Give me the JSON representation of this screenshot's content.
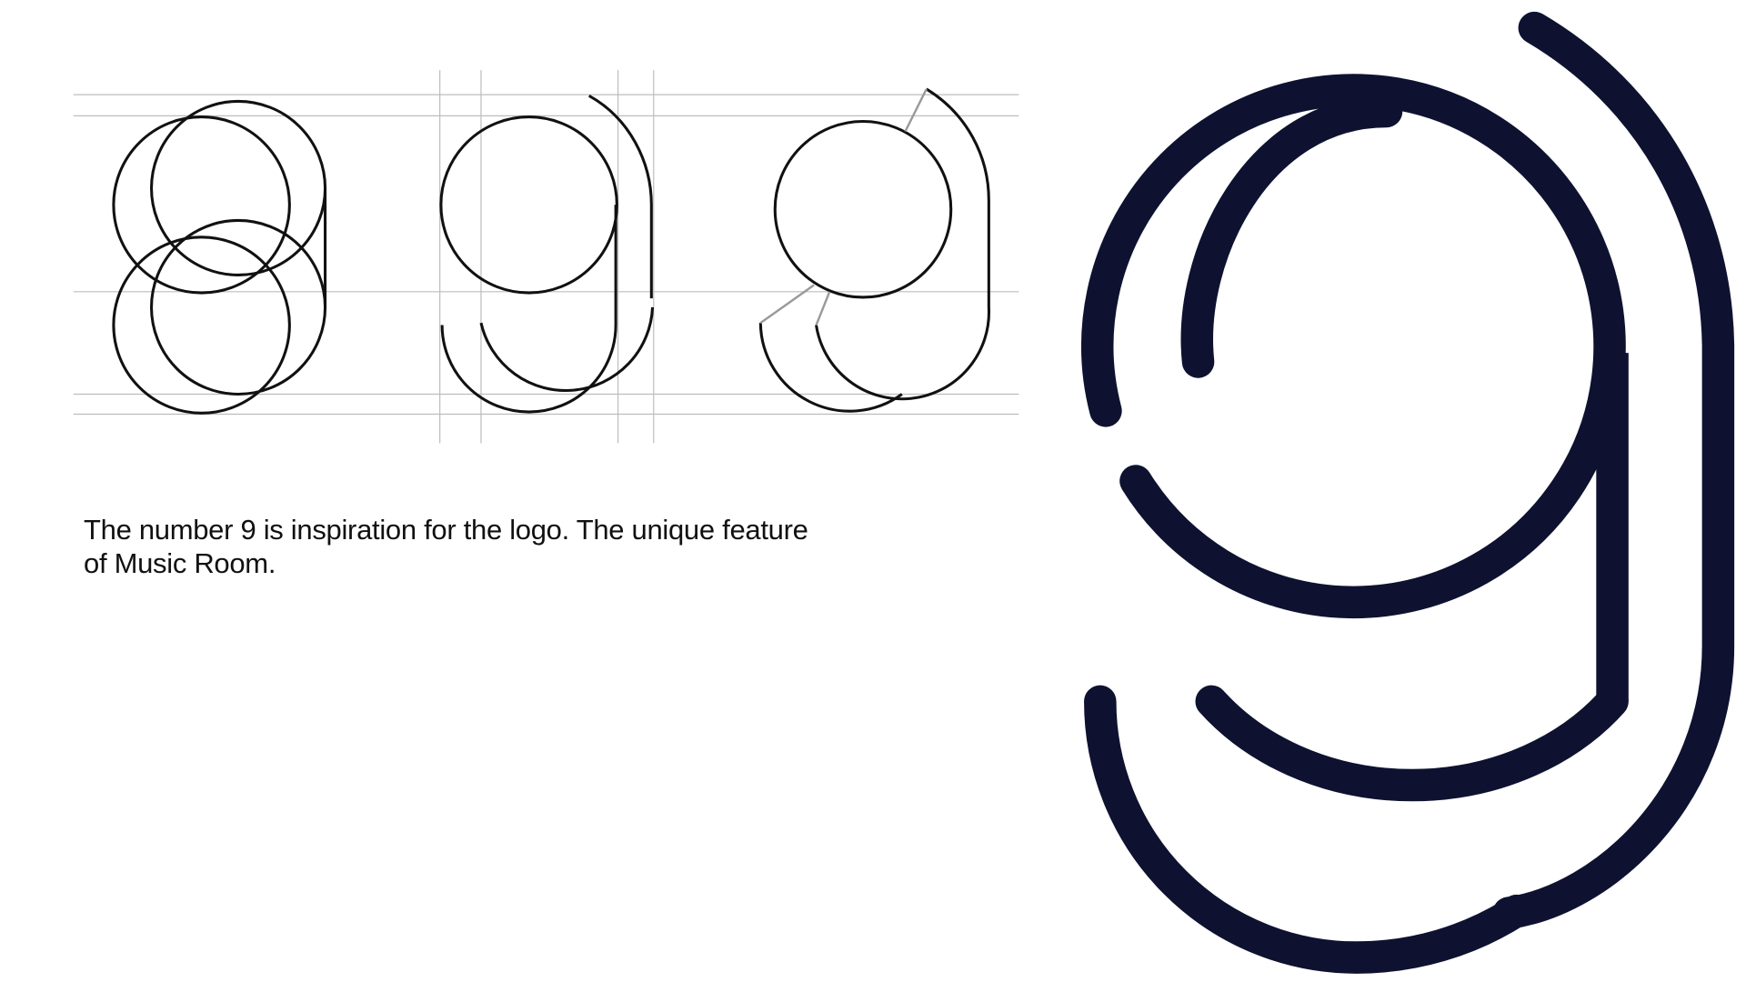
{
  "caption": {
    "line1": "The number 9 is inspiration for the logo. The unique feature",
    "line2": "of Music Room."
  },
  "colors": {
    "logo": "#0e1230",
    "construction_stroke": "#111111",
    "guide_lines": "#bdbdbd",
    "helper_lines": "#9a9a9a"
  }
}
